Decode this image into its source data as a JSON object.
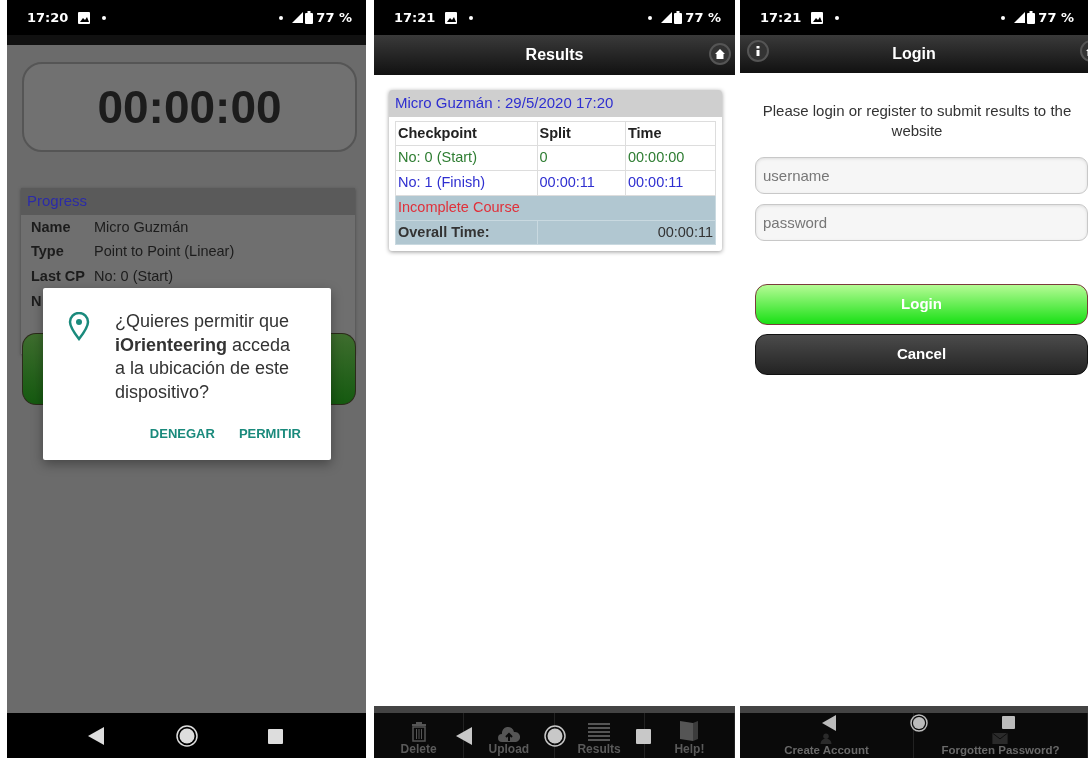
{
  "screens": [
    {
      "kind": "timer",
      "status_bar": {
        "time": "17:20",
        "battery": "77 %"
      },
      "timer": "00:00:00",
      "progress": {
        "title": "Progress",
        "rows": [
          {
            "label": "Name",
            "value": "Micro Guzmán"
          },
          {
            "label": "Type",
            "value": "Point to Point (Linear)"
          },
          {
            "label": "Last CP",
            "value": "No: 0 (Start)"
          },
          {
            "label": "N"
          }
        ]
      },
      "dialog": {
        "message": "¿Quieres permitir que **iOrienteering** acceda a la ubicación de este dispositivo?",
        "buttons": [
          "DENEGAR",
          "PERMITIR"
        ]
      }
    },
    {
      "kind": "results",
      "status_bar": {
        "time": "17:21",
        "battery": "77 %"
      },
      "title": "Results",
      "result": {
        "heading": "Micro Guzmán : 29/5/2020 17:20",
        "columns": [
          "Checkpoint",
          "Split",
          "Time"
        ],
        "rows": [
          {
            "cells": [
              "No: 0 (Start)",
              "0",
              "00:00:00"
            ],
            "color": "#2e7d32"
          },
          {
            "cells": [
              "No: 1 (Finish)",
              "00:00:11",
              "00:00:11"
            ],
            "color": "#2f2fd0"
          }
        ],
        "status": "Incomplete Course",
        "overall_label": "Overall Time:",
        "overall_value": "00:00:11"
      },
      "toolbar": [
        "Delete",
        "Upload",
        "Results",
        "Help!"
      ]
    },
    {
      "kind": "login",
      "status_bar": {
        "time": "17:21",
        "battery": "77 %"
      },
      "title": "Login",
      "message": "Please login or register to submit results to the website",
      "fields": [
        {
          "placeholder": "username"
        },
        {
          "placeholder": "password"
        }
      ],
      "buttons": [
        {
          "label": "Login",
          "kind": "primary"
        },
        {
          "label": "Cancel",
          "kind": "secondary"
        }
      ],
      "toolbar": [
        "Create Account",
        "Forgotten Password?"
      ]
    }
  ]
}
